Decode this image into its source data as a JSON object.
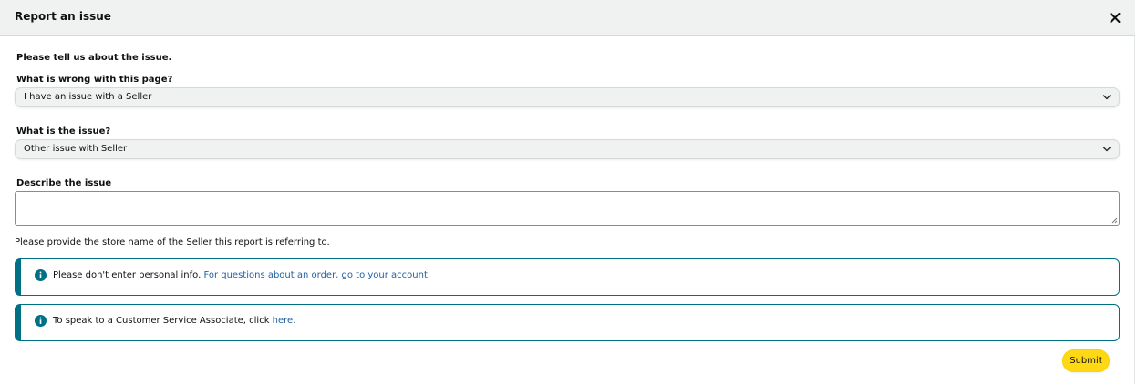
{
  "modal": {
    "title": "Report an issue",
    "close_icon": "close-icon"
  },
  "form": {
    "intro": "Please tell us about the issue.",
    "question1": {
      "label": "What is wrong with this page?",
      "value": "I have an issue with a Seller"
    },
    "question2": {
      "label": "What is the issue?",
      "value": "Other issue with Seller"
    },
    "describe": {
      "label": "Describe the issue",
      "value": ""
    },
    "helper_text": "Please provide the store name of the Seller this report is referring to."
  },
  "alerts": [
    {
      "icon": "info-icon",
      "text": "Please don't enter personal info. ",
      "link": "For questions about an order, go to your account."
    },
    {
      "icon": "info-icon",
      "text": "To speak to a Customer Service Associate, click ",
      "link": "here."
    }
  ],
  "actions": {
    "submit_label": "Submit"
  },
  "colors": {
    "header_bg": "#f0f2f2",
    "alert_accent": "#007185",
    "link": "#2162a1",
    "submit_bg": "#ffd814"
  }
}
